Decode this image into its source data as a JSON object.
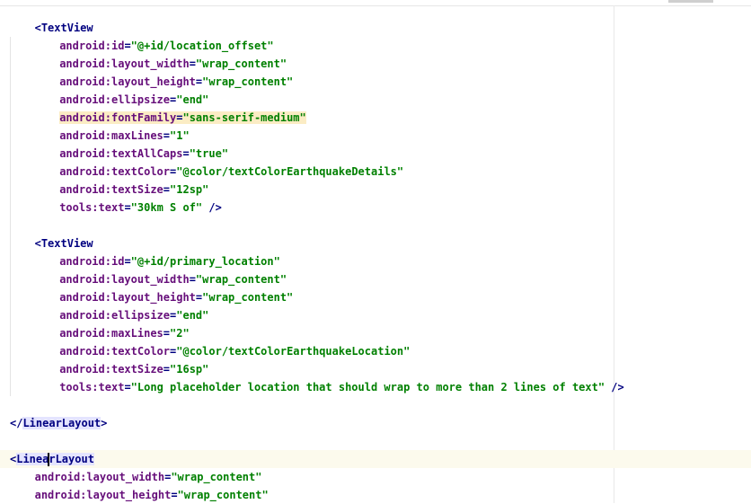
{
  "editor": {
    "lines": [
      {
        "indent": 4,
        "tag": "<TextView"
      },
      {
        "indent": 8,
        "attr": "android:id",
        "value": "\"@+id/location_offset\""
      },
      {
        "indent": 8,
        "attr": "android:layout_width",
        "value": "\"wrap_content\""
      },
      {
        "indent": 8,
        "attr": "android:layout_height",
        "value": "\"wrap_content\""
      },
      {
        "indent": 8,
        "attr": "android:ellipsize",
        "value": "\"end\""
      },
      {
        "indent": 8,
        "attr": "android:fontFamily",
        "value": "\"sans-serif-medium\"",
        "highlight": true
      },
      {
        "indent": 8,
        "attr": "android:maxLines",
        "value": "\"1\""
      },
      {
        "indent": 8,
        "attr": "android:textAllCaps",
        "value": "\"true\""
      },
      {
        "indent": 8,
        "attr": "android:textColor",
        "value": "\"@color/textColorEarthquakeDetails\""
      },
      {
        "indent": 8,
        "attr": "android:textSize",
        "value": "\"12sp\""
      },
      {
        "indent": 8,
        "attr": "tools:text",
        "value": "\"30km S of\"",
        "suffix": " />"
      },
      {
        "indent": 0
      },
      {
        "indent": 4,
        "tag": "<TextView"
      },
      {
        "indent": 8,
        "attr": "android:id",
        "value": "\"@+id/primary_location\""
      },
      {
        "indent": 8,
        "attr": "android:layout_width",
        "value": "\"wrap_content\""
      },
      {
        "indent": 8,
        "attr": "android:layout_height",
        "value": "\"wrap_content\""
      },
      {
        "indent": 8,
        "attr": "android:ellipsize",
        "value": "\"end\""
      },
      {
        "indent": 8,
        "attr": "android:maxLines",
        "value": "\"2\""
      },
      {
        "indent": 8,
        "attr": "android:textColor",
        "value": "\"@color/textColorEarthquakeLocation\""
      },
      {
        "indent": 8,
        "attr": "android:textSize",
        "value": "\"16sp\""
      },
      {
        "indent": 8,
        "attr": "tools:text",
        "value": "\"Long placeholder location that should wrap to more than 2 lines of text\"",
        "suffix": " />"
      },
      {
        "indent": 0
      },
      {
        "indent": 0,
        "tag": "</",
        "tagName": "LinearLayout",
        "tagEnd": ">",
        "tagHighlight": true
      },
      {
        "indent": 0
      },
      {
        "indent": 0,
        "tag": "<",
        "tagName": "LinearLayout",
        "tagHighlight": true,
        "caretAfter": 5
      },
      {
        "indent": 4,
        "attr": "android:layout_width",
        "value": "\"wrap_content\""
      },
      {
        "indent": 4,
        "attr": "android:layout_height",
        "value": "\"wrap_content\""
      }
    ]
  },
  "colors": {
    "tag": "#000080",
    "attribute": "#660e7a",
    "value": "#008000",
    "attribute_highlight": "#fbecc4",
    "tag_highlight": "#e4e4ff",
    "caret_line": "#fcfaed"
  }
}
